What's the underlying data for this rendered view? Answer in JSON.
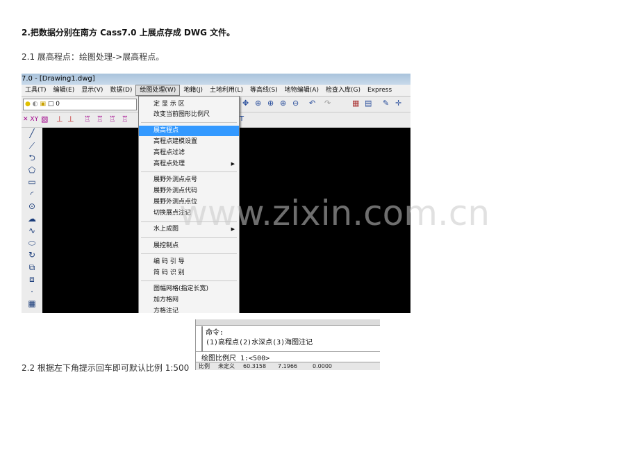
{
  "heading": "2.把数据分别在南方 Cass7.0 上展点存成 DWG 文件。",
  "step1": "2.1 展高程点：绘图处理->展高程点。",
  "step2": "2.2 根据左下角提示回车即可默认比例 1:500",
  "screenshot1": {
    "title": "7.0 - [Drawing1.dwg]",
    "menus": [
      "工具(T)",
      "编辑(E)",
      "显示(V)",
      "数据(D)",
      "绘图处理(W)",
      "地籍(J)",
      "土地利用(L)",
      "等高线(S)",
      "地物编辑(A)",
      "检查入库(G)",
      "Express"
    ],
    "active_menu": "绘图处理(W)",
    "layer_value": "0",
    "dropdown": [
      {
        "label": "定 显 示 区"
      },
      {
        "label": "改变当前图形比例尺"
      },
      {
        "label": "展高程点",
        "highlighted": true
      },
      {
        "label": "高程点建模设置"
      },
      {
        "label": "高程点过滤"
      },
      {
        "label": "高程点处理",
        "submenu": true
      },
      {
        "label": "展野外测点点号"
      },
      {
        "label": "展野外测点代码"
      },
      {
        "label": "展野外测点点位"
      },
      {
        "label": "切换展点注记"
      },
      {
        "label": "水上成图",
        "submenu": true
      },
      {
        "label": "展控制点"
      },
      {
        "label": "编 码 引 导"
      },
      {
        "label": "简 码 识 别"
      },
      {
        "label": "图幅网格(指定长宽)"
      },
      {
        "label": "加方格网"
      },
      {
        "label": "方格注记"
      }
    ]
  },
  "screenshot2": {
    "line1": "命令:",
    "line2": "(1)高程点(2)水深点(3)海图注记",
    "line3": "绘图比例尺 1:<500>",
    "status": [
      "比例",
      "未定义",
      "60.3158",
      "7.1966",
      "0.0000"
    ]
  },
  "watermark": "www.zixin.com.cn"
}
